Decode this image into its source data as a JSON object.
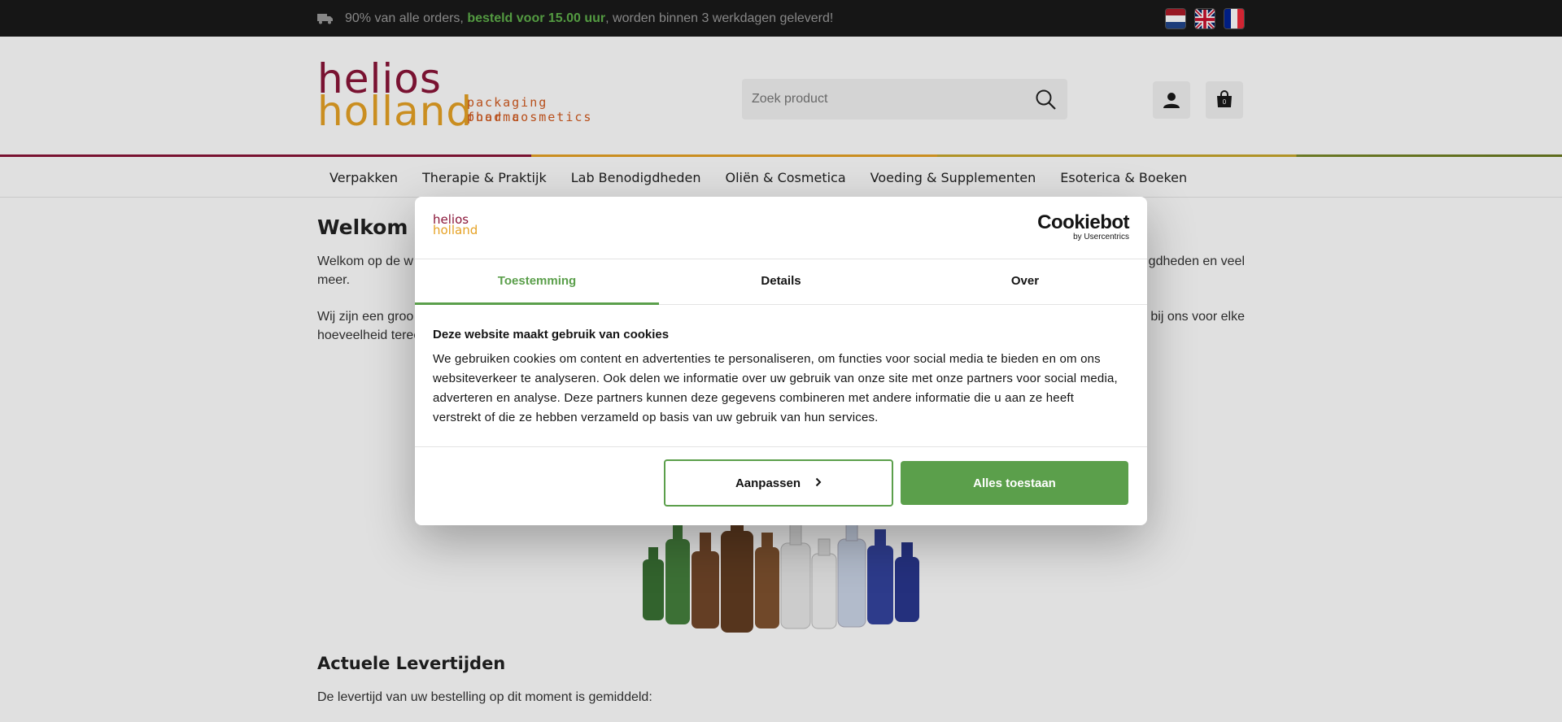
{
  "topbar": {
    "msg_before": "90% van alle orders, ",
    "msg_highlight": "besteld voor 15.00 uur",
    "msg_after": ", worden binnen 3 werkdagen geleverd!",
    "flags": [
      "nl-flag",
      "uk-flag",
      "fr-flag"
    ]
  },
  "header": {
    "logo_line1": "helios",
    "logo_line2": "holland",
    "logo_tag1": "packaging pharma",
    "logo_tag2": "food cosmetics",
    "search_placeholder": "Zoek product",
    "cart_count": "0"
  },
  "nav": {
    "items": [
      "Verpakken",
      "Therapie & Praktijk",
      "Lab Benodigdheden",
      "Oliën & Cosmetica",
      "Voeding & Supplementen",
      "Esoterica & Boeken"
    ]
  },
  "content": {
    "welcome": "Welkom b",
    "p1_left": "Welkom op de w",
    "p1_right": "gdheden en veel",
    "p1_line2": "meer.",
    "p2_left": "Wij zijn een groo",
    "p2_right": "bij ons voor elke",
    "p2_line2": "hoeveelheid terec",
    "section_heading": "Actuele Levertijden",
    "p3": "De levertijd van uw bestelling op dit moment is gemiddeld:"
  },
  "cookie": {
    "brand_name": "Cookiebot",
    "brand_by": "by Usercentrics",
    "logo_line1": "helios",
    "logo_line2": "holland",
    "tabs": [
      "Toestemming",
      "Details",
      "Over"
    ],
    "title": "Deze website maakt gebruik van cookies",
    "text": "We gebruiken cookies om content en advertenties te personaliseren, om functies voor social media te bieden en om ons websiteverkeer te analyseren. Ook delen we informatie over uw gebruik van onze site met onze partners voor social media, adverteren en analyse. Deze partners kunnen deze gegevens combineren met andere informatie die u aan ze heeft verstrekt of die ze hebben verzameld op basis van uw gebruik van hun services.",
    "customize_label": "Aanpassen",
    "allow_all_label": "Alles toestaan"
  },
  "colors": {
    "accent_green": "#5b9f4b",
    "topbar_bg": "#1a1a1a",
    "logo_red": "#8a1538",
    "logo_orange": "#e6a225"
  }
}
